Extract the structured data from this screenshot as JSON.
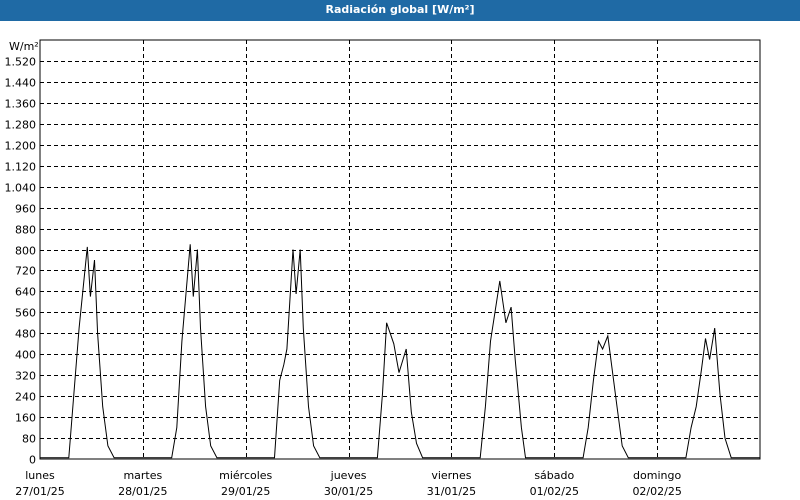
{
  "window": {
    "title": "Radiación global [W/m²]"
  },
  "chart_data": {
    "type": "line",
    "title": "Radiación global [W/m²]",
    "ylabel": "W/m²",
    "xlabel": "",
    "ylim": [
      0,
      1600
    ],
    "xlim": [
      0,
      7
    ],
    "grid": true,
    "y_ticks": [
      0,
      80,
      160,
      240,
      320,
      400,
      480,
      560,
      640,
      720,
      800,
      880,
      960,
      1040,
      1120,
      1200,
      1280,
      1360,
      1440,
      1520
    ],
    "y_tick_labels": [
      "0",
      "80",
      "160",
      "240",
      "320",
      "400",
      "480",
      "560",
      "640",
      "720",
      "800",
      "880",
      "960",
      "1.040",
      "1.120",
      "1.200",
      "1.280",
      "1.360",
      "1.440",
      "1.520"
    ],
    "x_days": [
      {
        "day": "lunes",
        "date": "27/01/25"
      },
      {
        "day": "martes",
        "date": "28/01/25"
      },
      {
        "day": "miércoles",
        "date": "29/01/25"
      },
      {
        "day": "jueves",
        "date": "30/01/25"
      },
      {
        "day": "viernes",
        "date": "31/01/25"
      },
      {
        "day": "sábado",
        "date": "01/02/25"
      },
      {
        "day": "domingo",
        "date": "02/02/25"
      }
    ],
    "series": [
      {
        "color": "#000000",
        "x": [
          0,
          0.28,
          0.33,
          0.38,
          0.46,
          0.49,
          0.53,
          0.56,
          0.61,
          0.66,
          0.72,
          1.0,
          1.28,
          1.33,
          1.38,
          1.46,
          1.49,
          1.53,
          1.56,
          1.61,
          1.66,
          1.72,
          2.0,
          2.28,
          2.33,
          2.37,
          2.4,
          2.46,
          2.49,
          2.53,
          2.56,
          2.61,
          2.66,
          2.72,
          3.0,
          3.28,
          3.33,
          3.37,
          3.44,
          3.49,
          3.56,
          3.61,
          3.66,
          3.72,
          4.0,
          4.28,
          4.33,
          4.38,
          4.47,
          4.53,
          4.58,
          4.62,
          4.68,
          4.72,
          5.0,
          5.28,
          5.33,
          5.38,
          5.43,
          5.47,
          5.52,
          5.56,
          5.61,
          5.66,
          5.72,
          6.0,
          6.28,
          6.33,
          6.38,
          6.43,
          6.47,
          6.51,
          6.56,
          6.61,
          6.66,
          6.72,
          7.0
        ],
        "values": [
          5,
          5,
          250,
          500,
          810,
          620,
          760,
          480,
          200,
          50,
          5,
          5,
          5,
          120,
          450,
          820,
          620,
          800,
          500,
          200,
          50,
          5,
          5,
          5,
          300,
          360,
          420,
          800,
          630,
          800,
          500,
          200,
          50,
          5,
          5,
          5,
          250,
          520,
          440,
          330,
          420,
          180,
          60,
          5,
          5,
          5,
          200,
          450,
          680,
          520,
          580,
          380,
          120,
          5,
          5,
          5,
          120,
          300,
          450,
          420,
          470,
          350,
          200,
          50,
          5,
          5,
          5,
          120,
          200,
          340,
          460,
          380,
          500,
          250,
          80,
          5,
          5
        ]
      }
    ]
  }
}
